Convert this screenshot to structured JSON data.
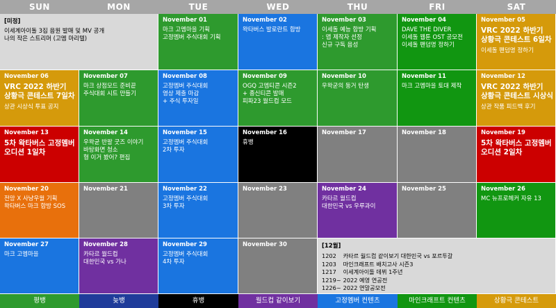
{
  "weekdays": [
    "SUN",
    "MON",
    "TUE",
    "WED",
    "THU",
    "FRI",
    "SAT"
  ],
  "colors": {
    "header": "#a6a6a6",
    "light_gray": "#d9d9d9",
    "gray": "#808080",
    "green": "#2e9a2e",
    "dark_green": "#119611",
    "blue": "#1a75e0",
    "gold": "#d59a0b",
    "red": "#cc0000",
    "purple": "#7030a0",
    "orange": "#e8700c",
    "black": "#000000"
  },
  "unscheduled": {
    "title": "[미정]",
    "lines": [
      "이세계아이돌 3집 음원 발매 및 MV 공개",
      "나의 작은 스트리머 (고멤 마리텔)"
    ]
  },
  "days": [
    {
      "date": "November 01",
      "color": "green",
      "lines": [
        "마크 고멤마을 기획",
        "고정멤버 주식대회 기획"
      ]
    },
    {
      "date": "November 02",
      "color": "blue",
      "lines": [
        "왁타버스 발로란트 합방"
      ]
    },
    {
      "date": "November 03",
      "color": "green",
      "lines": [
        "이세돌 예능 합방 기획",
        ": 맵 제작자 선정",
        "신규 구독 음성"
      ]
    },
    {
      "date": "November 04",
      "color": "dark_green",
      "lines": [
        "DAVE THE DIVER",
        "이세돌 웹툰 OST 공모전",
        "이세돌 팬덤명 정하기"
      ]
    },
    {
      "date": "November 05",
      "color": "gold",
      "lines": [
        "VRC 2022 하반기",
        "상황극 콘테스트 6일차",
        "",
        "이세돌 팬덤명 정하기"
      ]
    },
    {
      "date": "November 06",
      "color": "gold",
      "lines": [
        "VRC 2022 하반기",
        "상황극 콘테스트 7일차",
        "",
        "상관 시상식 투표 공지"
      ]
    },
    {
      "date": "November 07",
      "color": "green",
      "lines": [
        "마크 상점모드 준비끝",
        "주식대회 시트 만들기"
      ]
    },
    {
      "date": "November 08",
      "color": "blue",
      "lines": [
        "고정멤버 주식대회",
        "영상 제출 마감",
        "+ 주식 투자일"
      ]
    },
    {
      "date": "November 09",
      "color": "green",
      "lines": [
        "OGQ 고멤티콘 시즌2",
        "+ 종신티콘 발매",
        "피파23 월드컵 모드"
      ]
    },
    {
      "date": "November 10",
      "color": "green",
      "lines": [
        "우왁굳의 둥거 탄생"
      ]
    },
    {
      "date": "November 11",
      "color": "dark_green",
      "lines": [
        "마크 고멤마을 토대 제작"
      ]
    },
    {
      "date": "November 12",
      "color": "gold",
      "lines": [
        "VRC 2022 하반기",
        "상황극 콘테스트 시상식",
        "",
        "상관 작품 피드백 후기"
      ]
    },
    {
      "date": "November 13",
      "color": "red",
      "lines": [
        "5차 왁타버스 고정멤버",
        "오디션 1일차"
      ]
    },
    {
      "date": "November 14",
      "color": "green",
      "lines": [
        "우왁굳 반팔 굿즈 이야기",
        "바탕화면 청소",
        "형 이거 봤어? 편집"
      ]
    },
    {
      "date": "November 15",
      "color": "blue",
      "lines": [
        "고정멤버 주식대회",
        "2차 투자"
      ]
    },
    {
      "date": "November 16",
      "color": "black",
      "lines": [
        "휴뱅"
      ]
    },
    {
      "date": "November 17",
      "color": "gray",
      "lines": []
    },
    {
      "date": "November 18",
      "color": "gray",
      "lines": []
    },
    {
      "date": "November 19",
      "color": "red",
      "lines": [
        "5차 왁타버스 고정멤버",
        "오디션 2일차"
      ]
    },
    {
      "date": "November 20",
      "color": "orange",
      "lines": [
        "전망 X 사냥우월 기획",
        "왁타버스 마크 합방 SOS"
      ]
    },
    {
      "date": "November 21",
      "color": "gray",
      "lines": []
    },
    {
      "date": "November 22",
      "color": "blue",
      "lines": [
        "고정멤버 주식대회",
        "3차 투자"
      ]
    },
    {
      "date": "November 23",
      "color": "gray",
      "lines": []
    },
    {
      "date": "November 24",
      "color": "purple",
      "lines": [
        "카타르 월드컵",
        "대한민국 vs 우루과이"
      ]
    },
    {
      "date": "November 25",
      "color": "gray",
      "lines": []
    },
    {
      "date": "November 26",
      "color": "dark_green",
      "lines": [
        "MC 뉴프로헤커 자유 13"
      ]
    },
    {
      "date": "November 27",
      "color": "blue",
      "lines": [
        "마크 고멤마을"
      ]
    },
    {
      "date": "November 28",
      "color": "purple",
      "lines": [
        "카타르 월드컵",
        "대한민국 vs 가나"
      ]
    },
    {
      "date": "November 29",
      "color": "blue",
      "lines": [
        "고정멤버 주식대회",
        "4차 투자"
      ]
    },
    {
      "date": "November 30",
      "color": "gray",
      "lines": []
    }
  ],
  "december": {
    "title": "[12월]",
    "items": [
      {
        "code": "1202",
        "text": "카타르 월드컵 같이보기 대한민국 vs 포르투갈"
      },
      {
        "code": "1203",
        "text": "마인크래프트 배치고사 시즌3"
      },
      {
        "code": "1217",
        "text": "이세계아이돌 데뷔 1주년"
      },
      {
        "code": "1219~",
        "text": "2022 예영 연공전"
      },
      {
        "code": "1226~",
        "text": "2022 연말공모전"
      }
    ]
  },
  "legend": [
    {
      "label": "평뱅",
      "color": "#2e9a2e"
    },
    {
      "label": "늦뱅",
      "color": "#1f3c9a"
    },
    {
      "label": "휴뱅",
      "color": "#000000"
    },
    {
      "label": "월드컵 같이보기",
      "color": "#7030a0"
    },
    {
      "label": "고정멤버 컨텐츠",
      "color": "#1a75e0"
    },
    {
      "label": "마인크래프트 컨텐츠",
      "color": "#119611"
    },
    {
      "label": "상황극 콘테스트",
      "color": "#d59a0b"
    }
  ]
}
